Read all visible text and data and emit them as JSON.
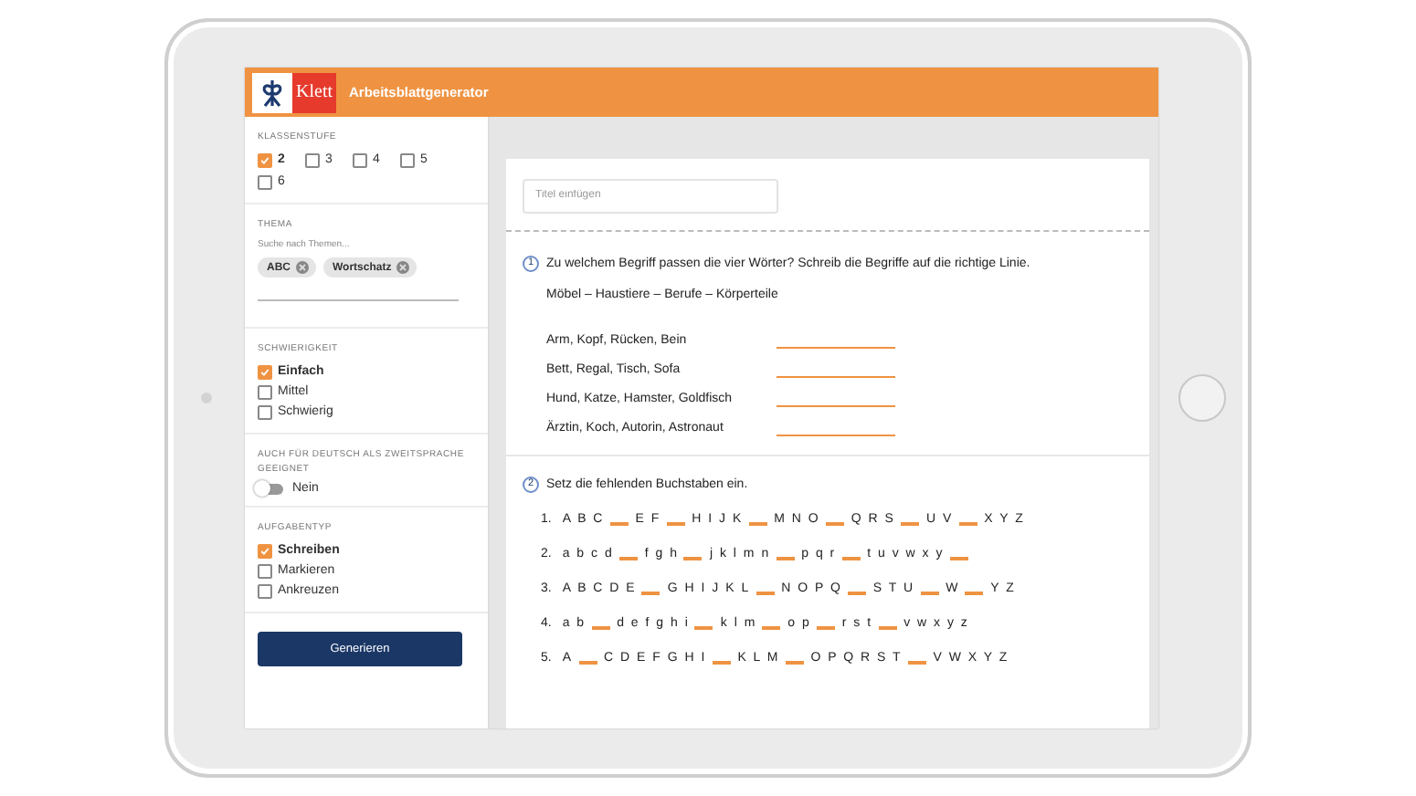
{
  "header": {
    "brand": "Klett",
    "title": "Arbeitsblattgenerator"
  },
  "sidebar": {
    "grade": {
      "label": "KLASSENSTUFE",
      "options": [
        {
          "label": "2",
          "checked": true
        },
        {
          "label": "3",
          "checked": false
        },
        {
          "label": "4",
          "checked": false
        },
        {
          "label": "5",
          "checked": false
        },
        {
          "label": "6",
          "checked": false
        }
      ]
    },
    "topic": {
      "label": "THEMA",
      "placeholder": "Suche nach Themen...",
      "tags": [
        "ABC",
        "Wortschatz"
      ]
    },
    "difficulty": {
      "label": "SCHWIERIGKEIT",
      "options": [
        {
          "label": "Einfach",
          "checked": true
        },
        {
          "label": "Mittel",
          "checked": false
        },
        {
          "label": "Schwierig",
          "checked": false
        }
      ]
    },
    "daz": {
      "label": "AUCH FÜR DEUTSCH ALS ZWEITSPRACHE GEEIGNET",
      "toggle_label": "Nein",
      "on": false
    },
    "task_type": {
      "label": "AUFGABENTYP",
      "options": [
        {
          "label": "Schreiben",
          "checked": true
        },
        {
          "label": "Markieren",
          "checked": false
        },
        {
          "label": "Ankreuzen",
          "checked": false
        }
      ]
    },
    "button": "Generieren"
  },
  "worksheet": {
    "title_field": {
      "placeholder": "Titel einfügen"
    },
    "task1": {
      "number": "1",
      "instruction": "Zu welchem Begriff passen die vier Wörter? Schreib die Begriffe auf die richtige Linie.",
      "terms": "Möbel – Haustiere – Berufe – Körperteile",
      "items": [
        "Arm, Kopf, Rücken, Bein",
        "Bett, Regal, Tisch, Sofa",
        "Hund, Katze, Hamster, Goldfisch",
        "Ärztin, Koch, Autorin, Astronaut"
      ]
    },
    "task2": {
      "number": "2",
      "instruction": "Setz die fehlenden Buchstaben ein.",
      "rows": [
        {
          "number": "1.",
          "parts": [
            {
              "kind": "text",
              "text": "A B C"
            },
            {
              "kind": "blank"
            },
            {
              "kind": "text",
              "text": "E F"
            },
            {
              "kind": "blank"
            },
            {
              "kind": "text",
              "text": "H I J K"
            },
            {
              "kind": "blank"
            },
            {
              "kind": "text",
              "text": "M N O"
            },
            {
              "kind": "blank"
            },
            {
              "kind": "text",
              "text": "Q R S"
            },
            {
              "kind": "blank"
            },
            {
              "kind": "text",
              "text": "U V"
            },
            {
              "kind": "blank"
            },
            {
              "kind": "text",
              "text": "X Y Z"
            }
          ]
        },
        {
          "number": "2.",
          "parts": [
            {
              "kind": "text",
              "text": "a b c d"
            },
            {
              "kind": "blank"
            },
            {
              "kind": "text",
              "text": "f g h"
            },
            {
              "kind": "blank"
            },
            {
              "kind": "text",
              "text": "j k l m n"
            },
            {
              "kind": "blank"
            },
            {
              "kind": "text",
              "text": "p q r"
            },
            {
              "kind": "blank"
            },
            {
              "kind": "text",
              "text": "t u v w x y"
            },
            {
              "kind": "blank"
            }
          ]
        },
        {
          "number": "3.",
          "parts": [
            {
              "kind": "text",
              "text": "A B C D E"
            },
            {
              "kind": "blank"
            },
            {
              "kind": "text",
              "text": "G H I J K L"
            },
            {
              "kind": "blank"
            },
            {
              "kind": "text",
              "text": "N O P Q"
            },
            {
              "kind": "blank"
            },
            {
              "kind": "text",
              "text": "S T U"
            },
            {
              "kind": "blank"
            },
            {
              "kind": "text",
              "text": "W"
            },
            {
              "kind": "blank"
            },
            {
              "kind": "text",
              "text": "Y Z"
            }
          ]
        },
        {
          "number": "4.",
          "parts": [
            {
              "kind": "text",
              "text": "a b"
            },
            {
              "kind": "blank"
            },
            {
              "kind": "text",
              "text": "d e f g h i"
            },
            {
              "kind": "blank"
            },
            {
              "kind": "text",
              "text": "k l m"
            },
            {
              "kind": "blank"
            },
            {
              "kind": "text",
              "text": "o p"
            },
            {
              "kind": "blank"
            },
            {
              "kind": "text",
              "text": "r s t"
            },
            {
              "kind": "blank"
            },
            {
              "kind": "text",
              "text": "v w x y z"
            }
          ]
        },
        {
          "number": "5.",
          "parts": [
            {
              "kind": "text",
              "text": "A"
            },
            {
              "kind": "blank"
            },
            {
              "kind": "text",
              "text": "C D E F G H I"
            },
            {
              "kind": "blank"
            },
            {
              "kind": "text",
              "text": "K L M"
            },
            {
              "kind": "blank"
            },
            {
              "kind": "text",
              "text": "O P Q R S T"
            },
            {
              "kind": "blank"
            },
            {
              "kind": "text",
              "text": "V W X Y Z"
            }
          ]
        }
      ]
    }
  }
}
